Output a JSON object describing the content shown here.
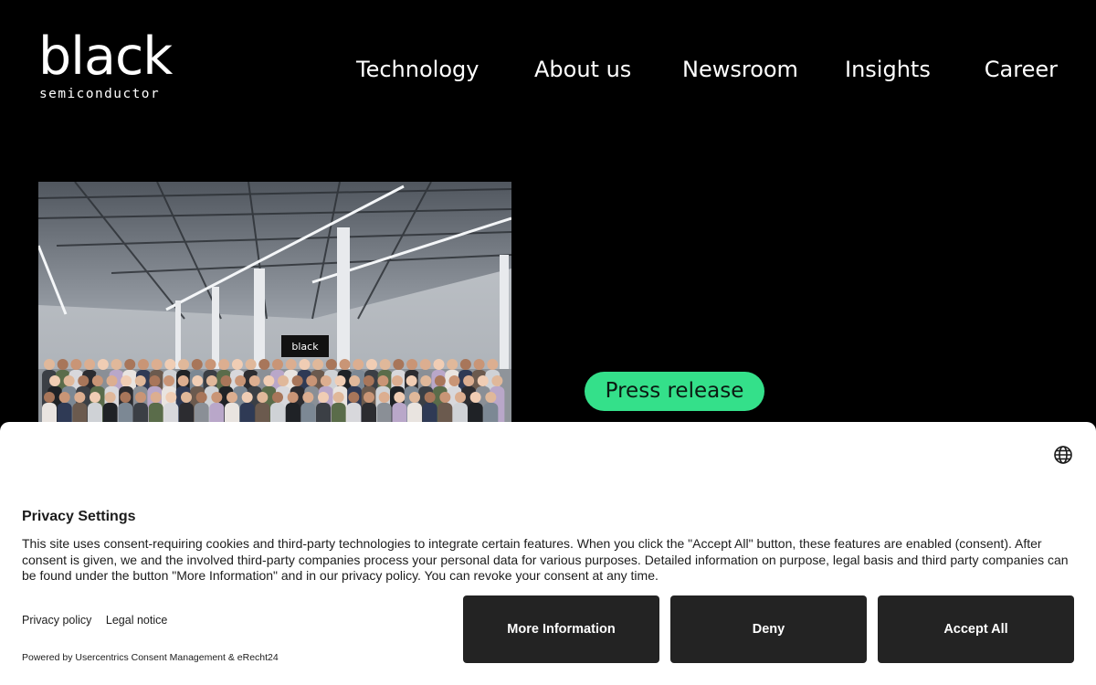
{
  "header": {
    "logo": {
      "word": "black",
      "sub": "semiconductor"
    },
    "nav": [
      "Technology",
      "About us",
      "Newsroom",
      "Insights",
      "Career"
    ]
  },
  "hero": {
    "photo_sign": "black",
    "badge": "Press release"
  },
  "consent": {
    "title": "Privacy Settings",
    "text": "This site uses consent-requiring cookies and third-party technologies to integrate certain features. When you click the \"Accept All\" button, these features are enabled (consent). After consent is given, we and the involved third-party companies process your personal data for various purposes. Detailed information on purpose, legal basis and third party companies can be found under the button \"More Information\" and in our privacy policy. You can revoke your consent at any time.",
    "links": {
      "privacy": "Privacy policy",
      "legal": "Legal notice"
    },
    "powered_by": "Powered by Usercentrics Consent Management & eRecht24",
    "buttons": {
      "more": "More Information",
      "deny": "Deny",
      "accept": "Accept All"
    },
    "language_icon": "globe-icon"
  },
  "colors": {
    "background": "#000000",
    "accent_green": "#34e08a",
    "button_dark": "#232323",
    "banner_bg": "#ffffff"
  }
}
